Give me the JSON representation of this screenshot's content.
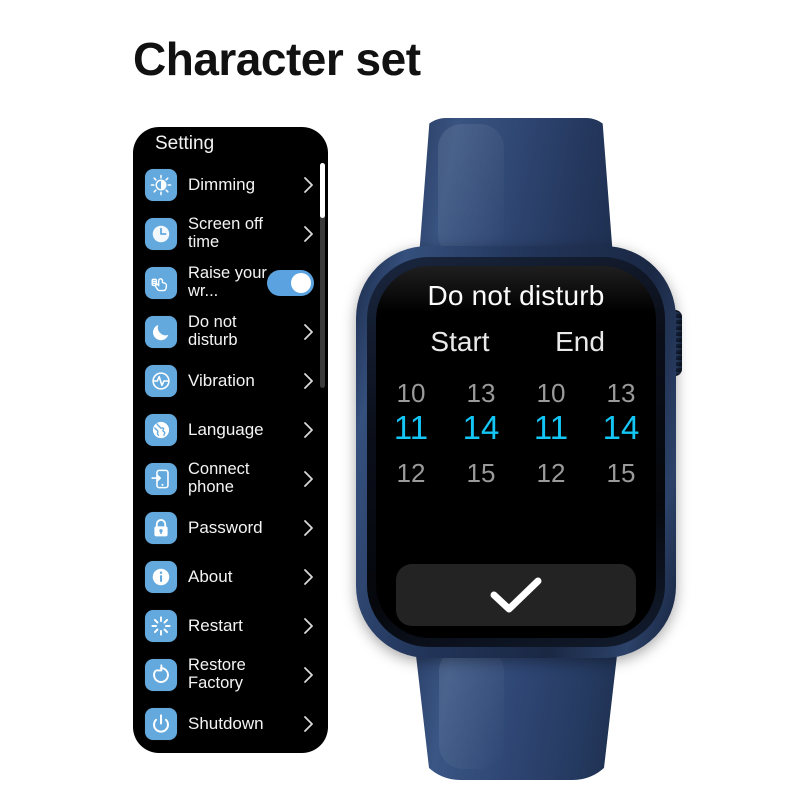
{
  "page": {
    "title": "Character set",
    "background": "#ffffff"
  },
  "settings_panel": {
    "header": "Setting",
    "background": "#000000",
    "icon_background": "#63a9de",
    "toggle_on_color": "#5ba3e0",
    "items": [
      {
        "label": "Dimming",
        "icon": "brightness-icon",
        "control": "chevron"
      },
      {
        "label": "Screen off time",
        "icon": "clock-icon",
        "control": "chevron"
      },
      {
        "label": "Raise your wr...",
        "icon": "raise-wrist-icon",
        "control": "toggle",
        "toggle_state": "on"
      },
      {
        "label": "Do not disturb",
        "icon": "moon-icon",
        "control": "chevron"
      },
      {
        "label": "Vibration",
        "icon": "vibration-icon",
        "control": "chevron"
      },
      {
        "label": "Language",
        "icon": "globe-icon",
        "control": "chevron"
      },
      {
        "label": "Connect phone",
        "icon": "connect-phone-icon",
        "control": "chevron"
      },
      {
        "label": "Password",
        "icon": "lock-icon",
        "control": "chevron"
      },
      {
        "label": "About",
        "icon": "info-icon",
        "control": "chevron"
      },
      {
        "label": "Restart",
        "icon": "restart-spinner-icon",
        "control": "chevron"
      },
      {
        "label": "Restore Factory",
        "icon": "restore-icon",
        "control": "chevron"
      },
      {
        "label": "Shutdown",
        "icon": "power-icon",
        "control": "chevron"
      }
    ]
  },
  "watch": {
    "band_color": "#2f4674",
    "case_color": "#22355a",
    "crown_label": "digital-crown",
    "screen": {
      "title": "Do not disturb",
      "columns": [
        {
          "heading": "Start"
        },
        {
          "heading": "End"
        }
      ],
      "selected_color": "#13c6f5",
      "dim_color": "#9a9a9a",
      "rows": {
        "previous": [
          "10",
          "13",
          "10",
          "13"
        ],
        "selected": [
          "11",
          "14",
          "11",
          "14"
        ],
        "next": [
          "12",
          "15",
          "12",
          "15"
        ]
      },
      "confirm_icon": "check-icon"
    }
  }
}
